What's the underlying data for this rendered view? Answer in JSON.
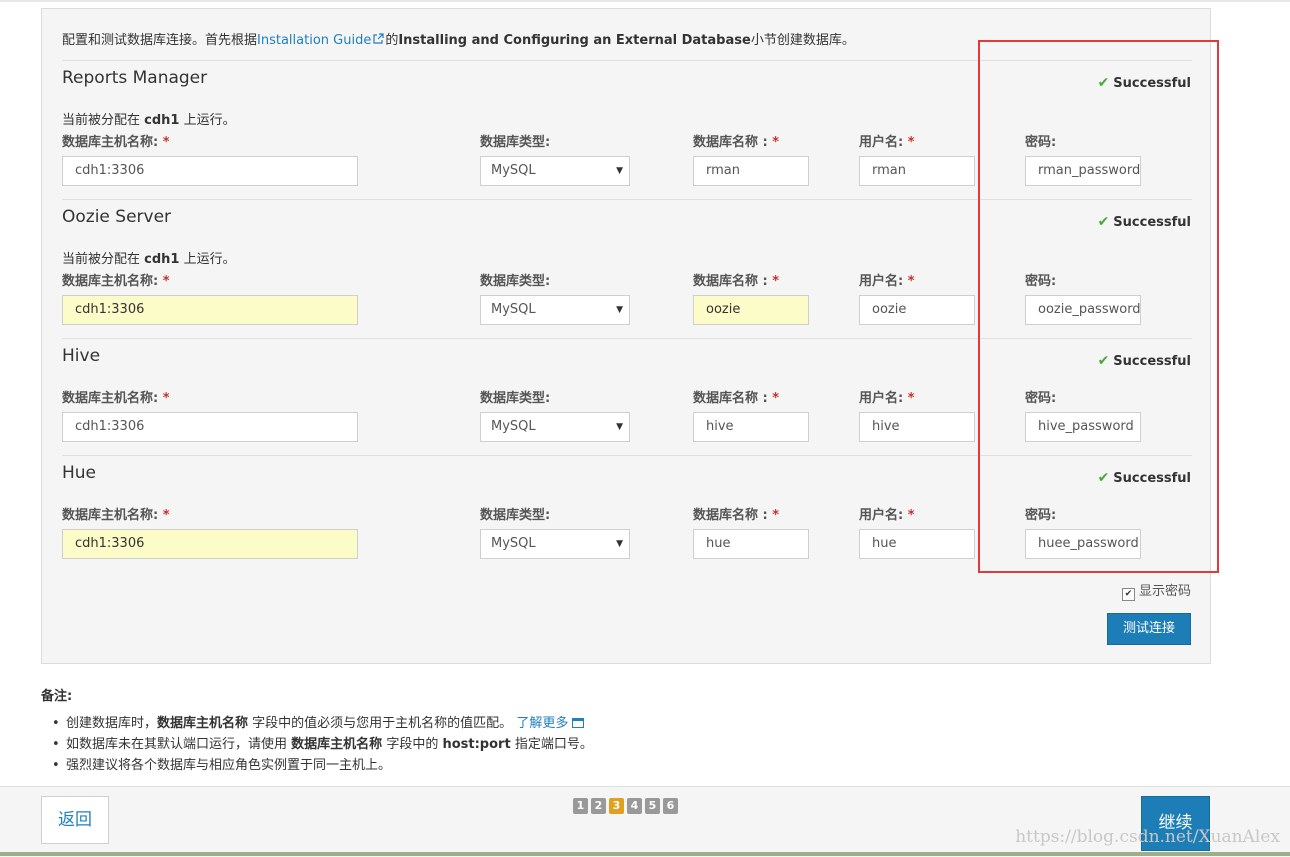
{
  "intro": {
    "prefix": "配置和测试数据库连接。首先根据",
    "link": "Installation Guide",
    "mid": "的",
    "bold": "Installing and Configuring an External Database",
    "suffix": "小节创建数据库。"
  },
  "labels": {
    "host": "数据库主机名称:",
    "type": "数据库类型:",
    "dbname": "数据库名称 :",
    "user": "用户名:",
    "password": "密码:",
    "required": "*",
    "assigned_prefix": "当前被分配在",
    "assigned_suffix": "上运行。"
  },
  "status": {
    "success": "Successful"
  },
  "sections": [
    {
      "title": "Reports Manager",
      "assigned_host": "cdh1",
      "host": "cdh1:3306",
      "db_type": "MySQL",
      "db_name": "rman",
      "user": "rman",
      "password": "rman_password"
    },
    {
      "title": "Oozie Server",
      "assigned_host": "cdh1",
      "host": "cdh1:3306",
      "db_type": "MySQL",
      "db_name": "oozie",
      "user": "oozie",
      "password": "oozie_password"
    },
    {
      "title": "Hive",
      "host": "cdh1:3306",
      "db_type": "MySQL",
      "db_name": "hive",
      "user": "hive",
      "password": "hive_password"
    },
    {
      "title": "Hue",
      "host": "cdh1:3306",
      "db_type": "MySQL",
      "db_name": "hue",
      "user": "hue",
      "password": "huee_password"
    }
  ],
  "show_password": "显示密码",
  "test_button": "测试连接",
  "notes": {
    "title": "备注:",
    "item1_a": "创建数据库时，",
    "item1_b": "数据库主机名称",
    "item1_c": "字段中的值必须与您用于主机名称的值匹配。",
    "item1_link": "了解更多",
    "item2_a": "如数据库未在其默认端口运行，请使用",
    "item2_b": "数据库主机名称",
    "item2_c": "字段中的",
    "item2_d": "host:port",
    "item2_e": "指定端口号。",
    "item3": "强烈建议将各个数据库与相应角色实例置于同一主机上。"
  },
  "footer": {
    "back": "返回",
    "next": "继续",
    "steps": [
      "1",
      "2",
      "3",
      "4",
      "5",
      "6"
    ],
    "active_step": "3",
    "watermark": "https://blog.csdn.net/XuanAlex"
  },
  "colors": {
    "accent": "#1d7db6",
    "success": "#4aa838",
    "highlight": "#fcfcc8",
    "annotation": "#e03a3a",
    "active_step": "#e0a020"
  }
}
